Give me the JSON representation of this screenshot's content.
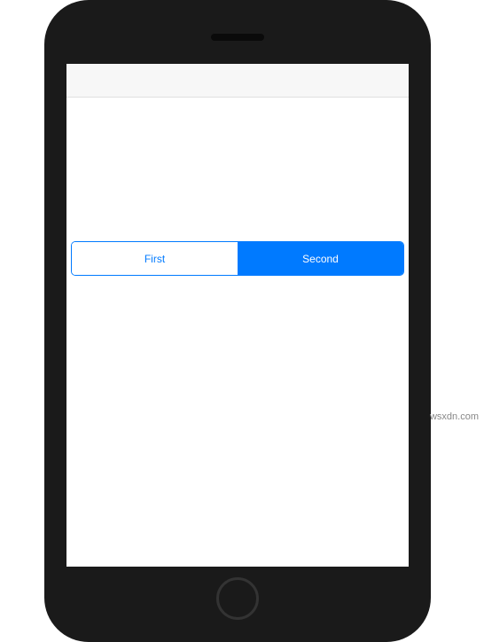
{
  "segmented_control": {
    "segments": [
      {
        "label": "First",
        "selected": false
      },
      {
        "label": "Second",
        "selected": true
      }
    ]
  },
  "colors": {
    "accent": "#007AFF",
    "frame": "#1a1a1a",
    "navbar": "#f7f7f7"
  },
  "watermark": "wsxdn.com"
}
